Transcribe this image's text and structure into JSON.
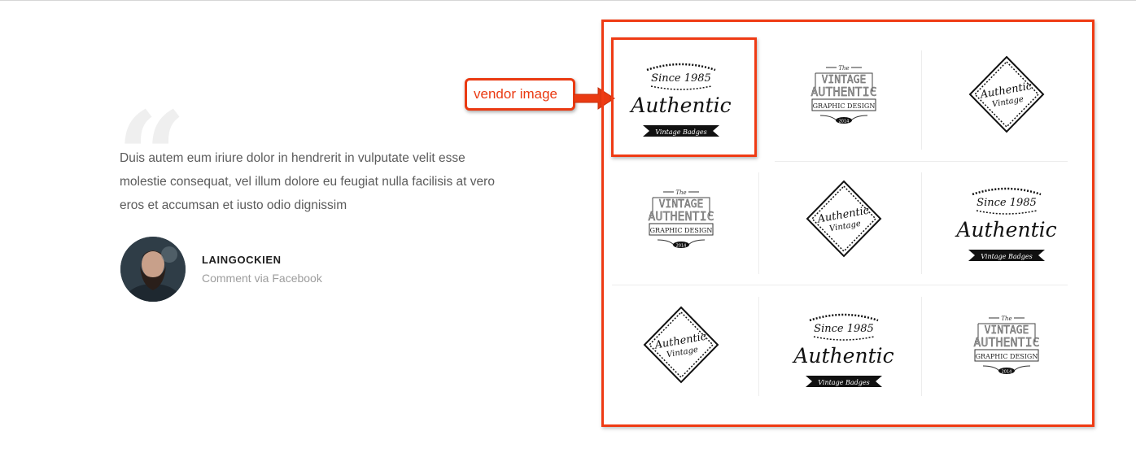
{
  "testimonial": {
    "text": " Duis autem eum iriure dolor in hendrerit in vulputate velit esse\nmolestie consequat, vel illum dolore eu feugiat nulla facilisis at vero\neros et accumsan et iusto odio dignissim",
    "author_name": "LAINGOCKIEN",
    "author_sub": "Comment via Facebook"
  },
  "callout": {
    "label": "vendor image",
    "color": "#ea3a12"
  },
  "logos": {
    "authentic_badge": {
      "top": "Since 1985",
      "main": "Authentic",
      "ribbon": "Vintage Badges"
    },
    "vintage_badge": {
      "the": "The",
      "line1": "VINTAGE",
      "line2": "AUTHENTIC",
      "line3": "GRAPHIC DESIGN",
      "year": "2014"
    },
    "diamond_badge": {
      "line1": "Authentic",
      "line2": "Vintage"
    },
    "grid": [
      "authentic_badge",
      "vintage_badge",
      "diamond_badge",
      "vintage_badge",
      "diamond_badge",
      "authentic_badge",
      "diamond_badge",
      "authentic_badge",
      "vintage_badge"
    ]
  }
}
